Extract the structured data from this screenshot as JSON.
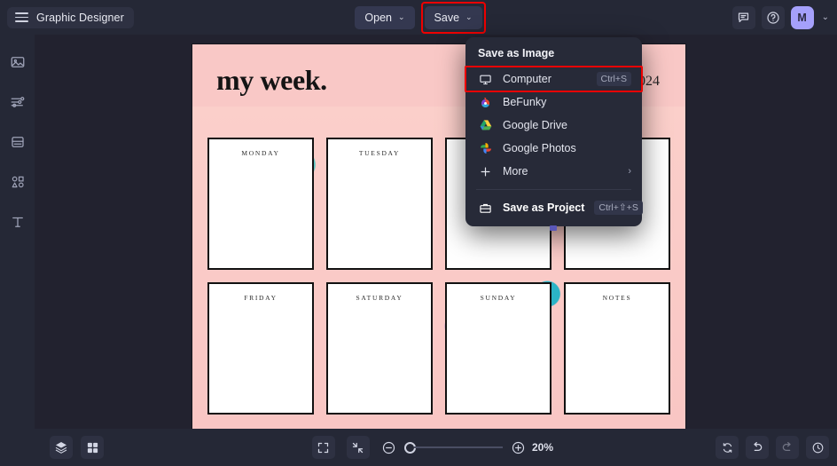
{
  "header": {
    "app_title": "Graphic Designer",
    "menu_icon": "hamburger-icon",
    "open_label": "Open",
    "save_label": "Save",
    "chevron": "⌄",
    "feedback_icon": "chat-icon",
    "help_icon": "help-circle-icon",
    "avatar_initial": "M",
    "avatar_caret": "⌄"
  },
  "sidebar": {
    "items": [
      {
        "name": "image-tool",
        "icon": "image-icon"
      },
      {
        "name": "adjust-tool",
        "icon": "sliders-icon"
      },
      {
        "name": "frames-tool",
        "icon": "layout-icon"
      },
      {
        "name": "shapes-tool",
        "icon": "shapes-icon"
      },
      {
        "name": "text-tool",
        "icon": "text-icon"
      }
    ]
  },
  "save_menu": {
    "title": "Save as Image",
    "items": [
      {
        "label": "Computer",
        "shortcut": "Ctrl+S",
        "icon": "monitor-icon",
        "highlighted": true
      },
      {
        "label": "BeFunky",
        "shortcut": "",
        "icon": "befunky-icon",
        "highlighted": false
      },
      {
        "label": "Google Drive",
        "shortcut": "",
        "icon": "google-drive-icon",
        "highlighted": false
      },
      {
        "label": "Google Photos",
        "shortcut": "",
        "icon": "google-photos-icon",
        "highlighted": false
      },
      {
        "label": "More",
        "shortcut": "",
        "icon": "plus-icon",
        "highlighted": false,
        "submenu_arrow": "›"
      }
    ],
    "project": {
      "label": "Save as Project",
      "shortcut": "Ctrl+⇧+S",
      "icon": "briefcase-icon"
    }
  },
  "canvas": {
    "title": "my week.",
    "year": "2024",
    "cells": [
      {
        "label": "MONDAY"
      },
      {
        "label": "TUESDAY"
      },
      {
        "label": ""
      },
      {
        "label": ""
      },
      {
        "label": "FRIDAY"
      },
      {
        "label": "SATURDAY"
      },
      {
        "label": "SUNDAY"
      },
      {
        "label": "NOTES"
      }
    ]
  },
  "bottom": {
    "layers_icon": "layers-icon",
    "templates_icon": "grid-icon",
    "fit_icon": "fit-screen-icon",
    "collapse_icon": "collapse-icon",
    "zoom_out_icon": "minus-circle-icon",
    "zoom_in_icon": "plus-circle-icon",
    "zoom_value": "20%",
    "reset_icon": "reset-icon",
    "undo_icon": "undo-icon",
    "redo_icon": "redo-icon",
    "history_icon": "history-icon"
  },
  "colors": {
    "chrome": "#252836",
    "workspace": "#22222f",
    "accent": "#a5a0fb",
    "highlight": "#ee0000"
  }
}
